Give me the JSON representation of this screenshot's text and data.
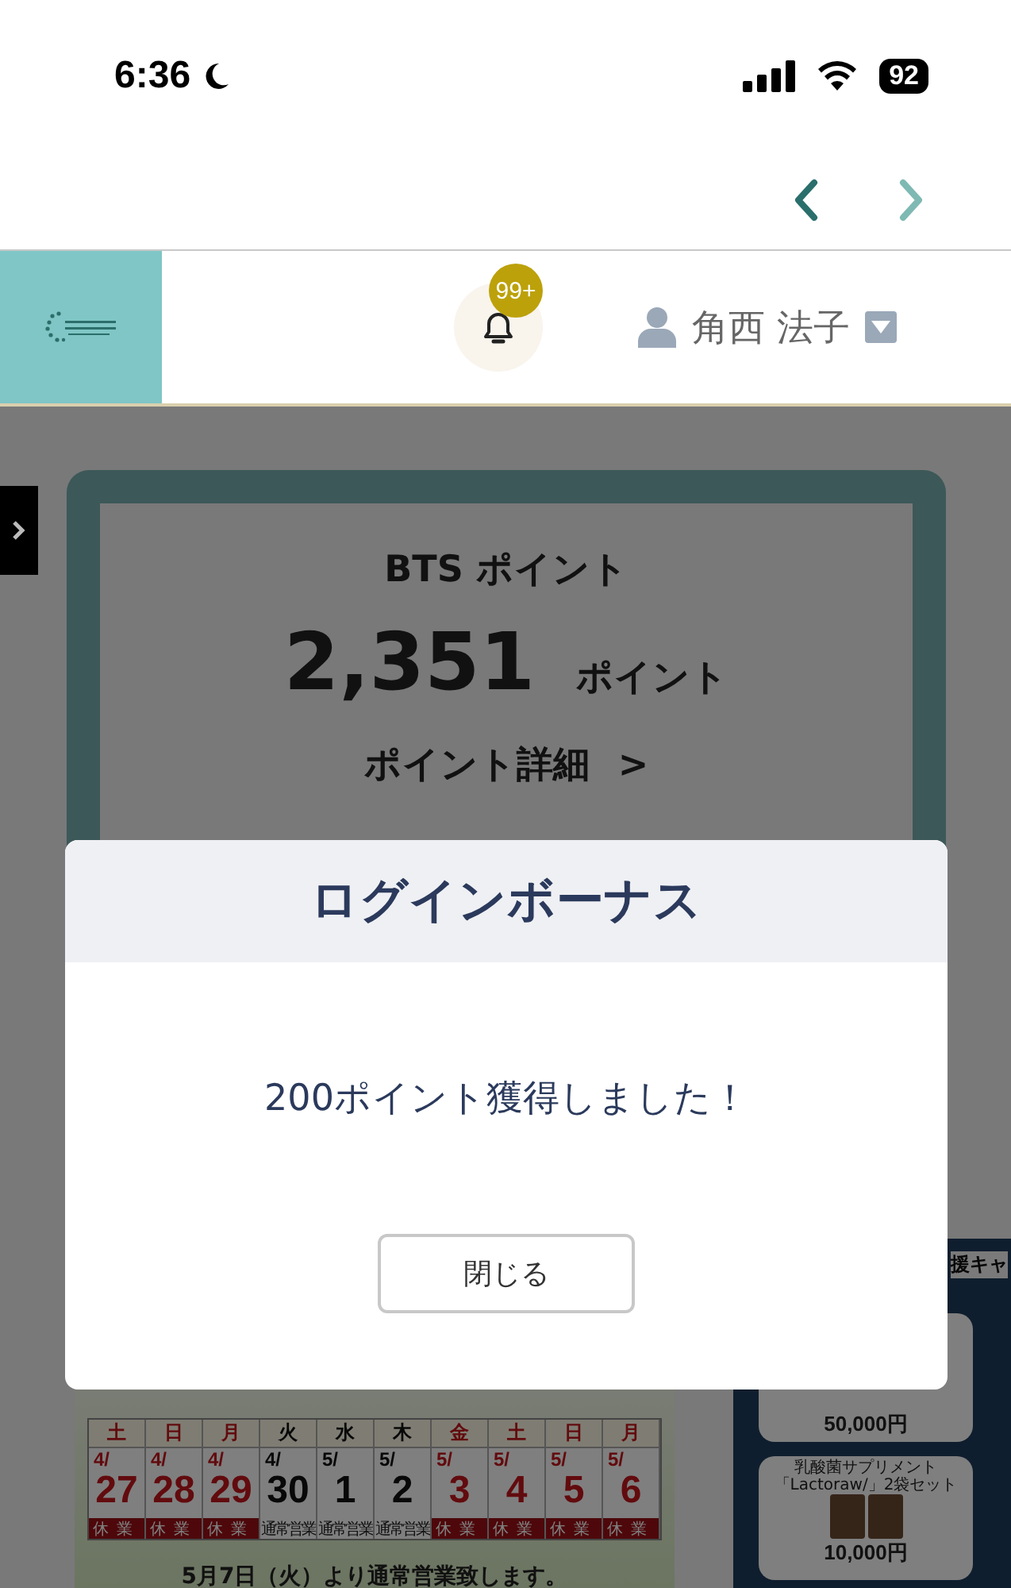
{
  "status_bar": {
    "time": "6:36",
    "battery": "92"
  },
  "nav": {
    "back": {
      "disabled": false
    },
    "forward": {
      "disabled": true
    }
  },
  "header": {
    "notification_badge": "99+",
    "user_name": "角西 法子"
  },
  "points_card": {
    "title": "BTS ポイント",
    "value": "2,351",
    "unit": "ポイント",
    "details_link": "ポイント詳細",
    "details_arrow": ">"
  },
  "holiday_banner": {
    "days": [
      {
        "weekday": "土",
        "month": "4/",
        "day": "27",
        "status": "休業",
        "closed": true
      },
      {
        "weekday": "日",
        "month": "4/",
        "day": "28",
        "status": "休業",
        "closed": true
      },
      {
        "weekday": "月",
        "month": "4/",
        "day": "29",
        "status": "休業",
        "closed": true
      },
      {
        "weekday": "火",
        "month": "4/",
        "day": "30",
        "status": "通常営業",
        "closed": false
      },
      {
        "weekday": "水",
        "month": "5/",
        "day": "1",
        "status": "通常営業",
        "closed": false
      },
      {
        "weekday": "木",
        "month": "5/",
        "day": "2",
        "status": "通常営業",
        "closed": false
      },
      {
        "weekday": "金",
        "month": "5/",
        "day": "3",
        "status": "休業",
        "closed": true
      },
      {
        "weekday": "土",
        "month": "5/",
        "day": "4",
        "status": "休業",
        "closed": true
      },
      {
        "weekday": "日",
        "month": "5/",
        "day": "5",
        "status": "休業",
        "closed": true
      },
      {
        "weekday": "月",
        "month": "5/",
        "day": "6",
        "status": "休業",
        "closed": true
      }
    ],
    "note": "5月7日（火）より通常営業致します。"
  },
  "campaign_banner": {
    "heading": "援キャ",
    "products": [
      {
        "price": "50,000円"
      },
      {
        "name": "乳酸菌サプリメント",
        "subtitle": "「Lactoraw/」2袋セット",
        "price": "10,000円"
      }
    ]
  },
  "modal": {
    "title": "ログインボーナス",
    "message": "200ポイント獲得しました！",
    "button": "閉じる"
  }
}
